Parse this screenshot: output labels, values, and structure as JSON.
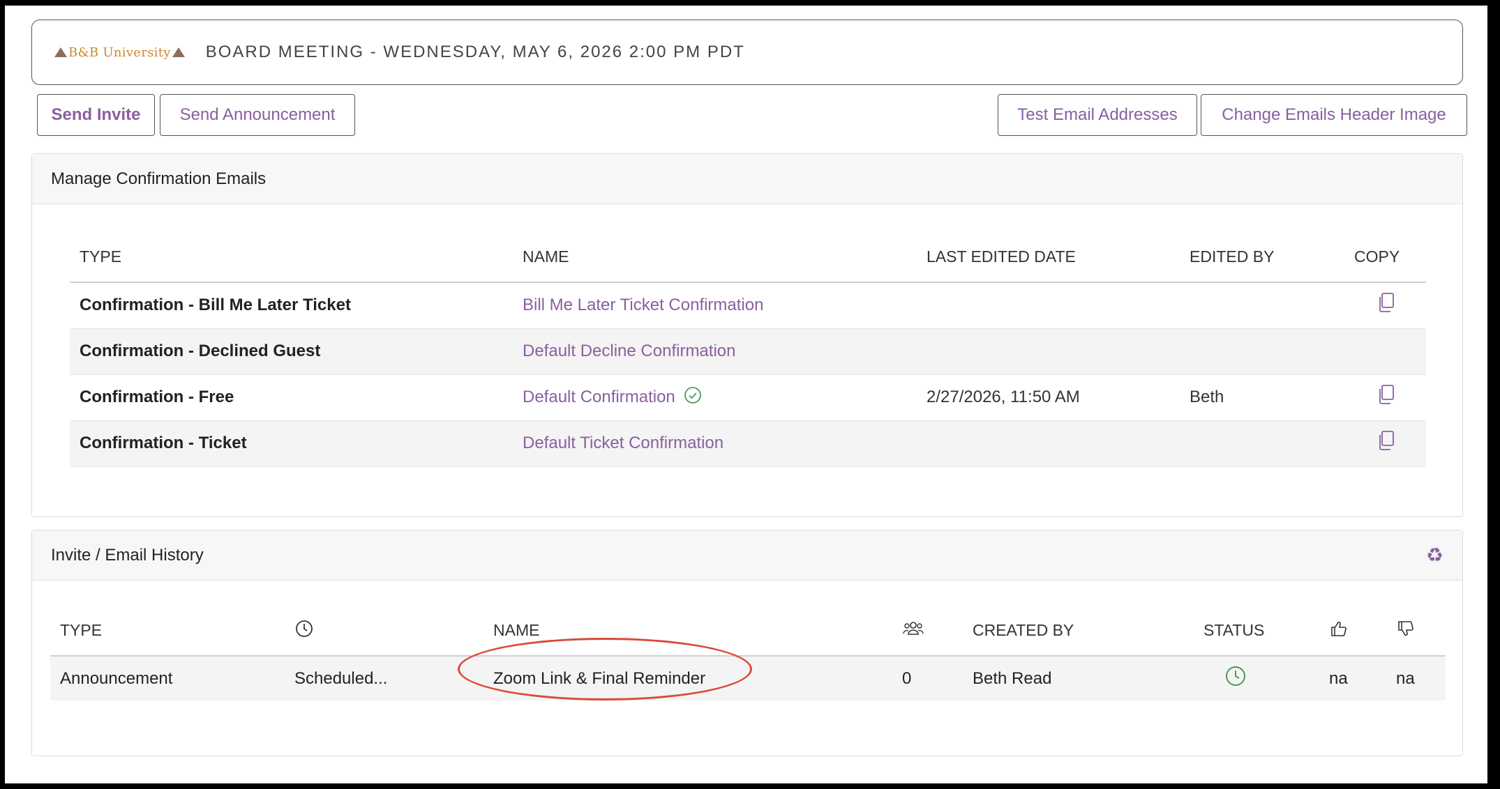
{
  "header": {
    "logo_text": "B&B University",
    "event_title": "BOARD MEETING - WEDNESDAY, MAY 6, 2026 2:00 PM PDT"
  },
  "toolbar": {
    "send_invite": "Send Invite",
    "send_announcement": "Send Announcement",
    "test_email_addresses": "Test Email Addresses",
    "change_header_image": "Change Emails Header Image"
  },
  "confirmation": {
    "title": "Manage Confirmation Emails",
    "columns": {
      "type": "TYPE",
      "name": "NAME",
      "last_edited": "LAST EDITED DATE",
      "edited_by": "EDITED BY",
      "copy": "COPY"
    },
    "rows": [
      {
        "type": "Confirmation - Bill Me Later Ticket",
        "name": "Bill Me Later Ticket Confirmation",
        "last_edited": "",
        "edited_by": "",
        "copy_icon": "copy-icon",
        "active": false
      },
      {
        "type": "Confirmation - Declined Guest",
        "name": "Default Decline Confirmation",
        "last_edited": "",
        "edited_by": "",
        "copy_icon": "",
        "active": false
      },
      {
        "type": "Confirmation - Free",
        "name": "Default Confirmation",
        "last_edited": "2/27/2026, 11:50 AM",
        "edited_by": "Beth",
        "copy_icon": "copy-icon",
        "active": true
      },
      {
        "type": "Confirmation - Ticket",
        "name": "Default Ticket Confirmation",
        "last_edited": "",
        "edited_by": "",
        "copy_icon": "copy-icon",
        "active": false
      }
    ]
  },
  "history": {
    "title": "Invite / Email History",
    "columns": {
      "type": "TYPE",
      "time_icon": "clock-icon",
      "name": "NAME",
      "recipients_icon": "people-icon",
      "created_by": "CREATED BY",
      "status": "STATUS",
      "likes_icon": "thumbs-up-icon",
      "dislikes_icon": "thumbs-down-icon"
    },
    "rows": [
      {
        "type": "Announcement",
        "time": "Scheduled...",
        "name": "Zoom Link & Final Reminder",
        "recipients": "0",
        "created_by": "Beth Read",
        "status_icon": "clock-icon",
        "likes": "na",
        "dislikes": "na"
      }
    ]
  },
  "colors": {
    "accent": "#8a5fa0",
    "status_green": "#4a9a5a",
    "highlight": "#d94a3a",
    "logo": "#c88a2e"
  }
}
